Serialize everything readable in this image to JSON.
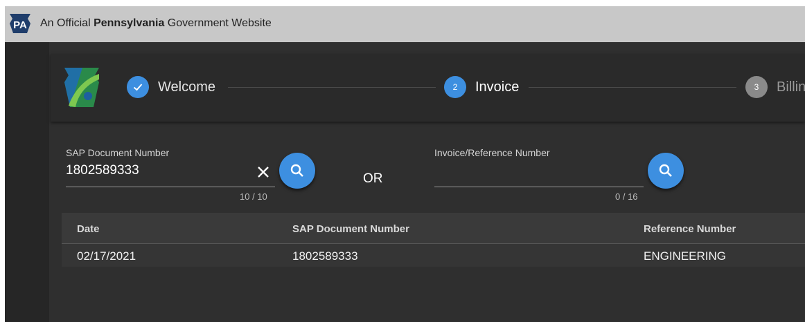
{
  "gov_banner": {
    "badge_text": "PA",
    "prefix": "An Official ",
    "state": "Pennsylvania",
    "suffix": " Government Website"
  },
  "stepper": {
    "steps": [
      {
        "label": "Welcome",
        "number": "",
        "state": "done"
      },
      {
        "label": "Invoice",
        "number": "2",
        "state": "active"
      },
      {
        "label": "Billin",
        "number": "3",
        "state": "pending"
      }
    ]
  },
  "search": {
    "sap": {
      "label": "SAP Document Number",
      "value": "1802589333",
      "counter": "10 / 10"
    },
    "or_label": "OR",
    "reference": {
      "label": "Invoice/Reference Number",
      "value": "",
      "counter": "0 / 16"
    }
  },
  "table": {
    "columns": [
      "Date",
      "SAP Document Number",
      "Reference Number"
    ],
    "rows": [
      [
        "02/17/2021",
        "1802589333",
        "ENGINEERING"
      ]
    ]
  },
  "colors": {
    "accent": "#3d8fe0",
    "background": "#2f2f2f",
    "banner": "#c8c8c8"
  },
  "icons": [
    "pa-keystone-badge-icon",
    "keystone-logo-icon",
    "check-icon",
    "close-icon",
    "search-icon"
  ]
}
